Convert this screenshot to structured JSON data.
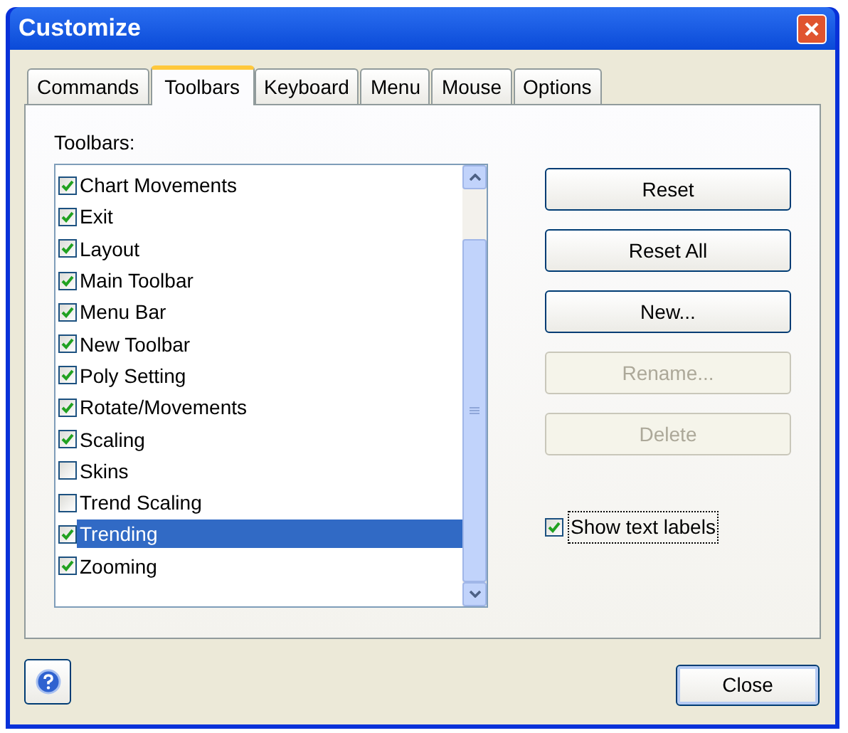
{
  "window": {
    "title": "Customize"
  },
  "tabs": [
    {
      "label": "Commands",
      "selected": false
    },
    {
      "label": "Toolbars",
      "selected": true
    },
    {
      "label": "Keyboard",
      "selected": false
    },
    {
      "label": "Menu",
      "selected": false
    },
    {
      "label": "Mouse",
      "selected": false
    },
    {
      "label": "Options",
      "selected": false
    }
  ],
  "toolbars_label": "Toolbars:",
  "toolbars": [
    {
      "name": "Chart Movements",
      "checked": true,
      "selected": false
    },
    {
      "name": "Exit",
      "checked": true,
      "selected": false
    },
    {
      "name": "Layout",
      "checked": true,
      "selected": false
    },
    {
      "name": "Main Toolbar",
      "checked": true,
      "selected": false
    },
    {
      "name": "Menu Bar",
      "checked": true,
      "selected": false
    },
    {
      "name": "New Toolbar",
      "checked": true,
      "selected": false
    },
    {
      "name": "Poly Setting",
      "checked": true,
      "selected": false
    },
    {
      "name": "Rotate/Movements",
      "checked": true,
      "selected": false
    },
    {
      "name": "Scaling",
      "checked": true,
      "selected": false
    },
    {
      "name": "Skins",
      "checked": false,
      "selected": false
    },
    {
      "name": "Trend Scaling",
      "checked": false,
      "selected": false
    },
    {
      "name": "Trending",
      "checked": true,
      "selected": true
    },
    {
      "name": "Zooming",
      "checked": true,
      "selected": false
    }
  ],
  "buttons": [
    {
      "label": "Reset",
      "disabled": false
    },
    {
      "label": "Reset All",
      "disabled": false
    },
    {
      "label": "New...",
      "disabled": false
    },
    {
      "label": "Rename...",
      "disabled": true
    },
    {
      "label": "Delete",
      "disabled": true
    }
  ],
  "show_text_labels": {
    "label": "Show text labels",
    "checked": true
  },
  "close_button": "Close"
}
